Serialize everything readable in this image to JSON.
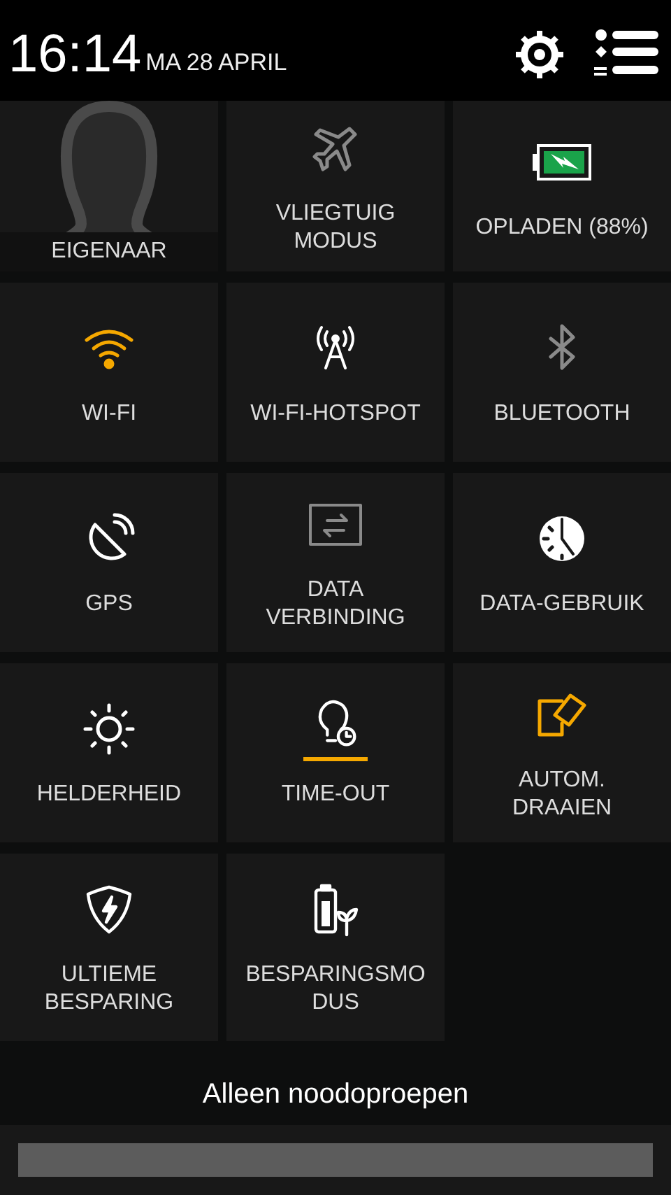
{
  "header": {
    "time": "16:14",
    "date": "MA 28 APRIL"
  },
  "tiles": [
    {
      "kind": "owner",
      "label": "EIGENAAR"
    },
    {
      "kind": "airplane",
      "label": "VLIEGTUIG\nMODUS",
      "on": false
    },
    {
      "kind": "battery",
      "label": "OPLADEN (88%)"
    },
    {
      "kind": "wifi",
      "label": "WI-FI",
      "on": true
    },
    {
      "kind": "hotspot",
      "label": "WI-FI-HOTSPOT"
    },
    {
      "kind": "bluetooth",
      "label": "BLUETOOTH",
      "on": false
    },
    {
      "kind": "gps",
      "label": "GPS"
    },
    {
      "kind": "data",
      "label": "DATA\nVERBINDING",
      "on": false
    },
    {
      "kind": "usage",
      "label": "DATA-GEBRUIK"
    },
    {
      "kind": "brightness",
      "label": "HELDERHEID"
    },
    {
      "kind": "timeout",
      "label": "TIME-OUT",
      "level": 1
    },
    {
      "kind": "rotate",
      "label": "AUTOM.\nDRAAIEN",
      "on": true
    },
    {
      "kind": "ultra",
      "label": "ULTIEME\nBESPARING"
    },
    {
      "kind": "saver",
      "label": "BESPARINGSMO\nDUS"
    }
  ],
  "carrier": "Alleen noodoproepen"
}
